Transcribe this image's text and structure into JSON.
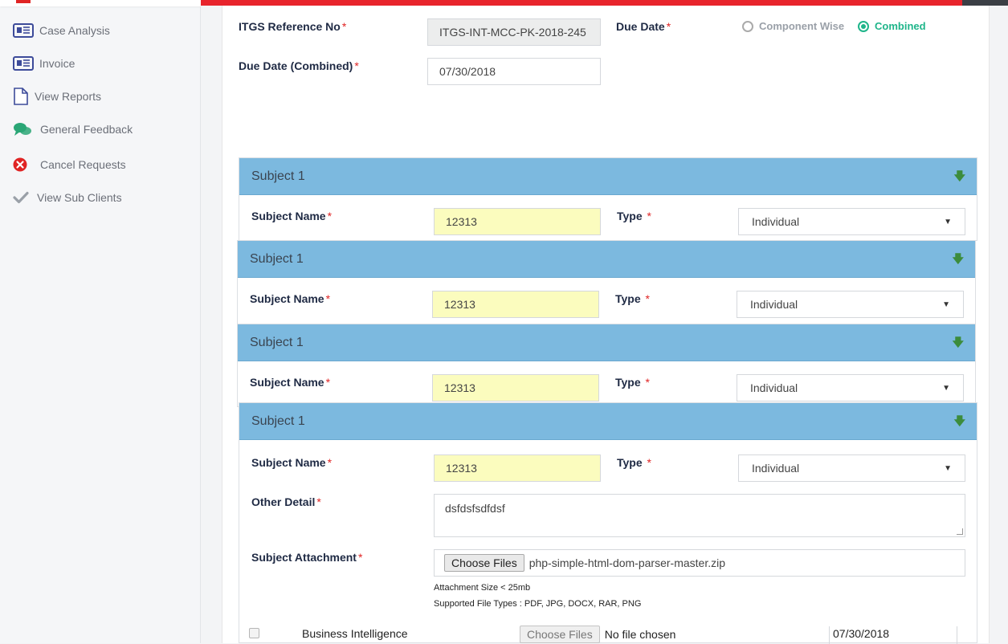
{
  "sidebar": {
    "items": [
      {
        "label": "Case Analysis",
        "icon": "newspaper-icon",
        "color": "#3d4b9a"
      },
      {
        "label": "Invoice",
        "icon": "newspaper-icon",
        "color": "#3d4b9a"
      },
      {
        "label": "View Reports",
        "icon": "document-icon",
        "color": "#3d4b9a"
      },
      {
        "label": "General Feedback",
        "icon": "comments-icon",
        "color": "#2aa676"
      },
      {
        "label": "Cancel Requests",
        "icon": "cancel-circle-icon",
        "color": "#e02424"
      },
      {
        "label": "View Sub Clients",
        "icon": "checkmark-icon",
        "color": "#9aa0a8"
      }
    ]
  },
  "form": {
    "itgs_ref_label": "ITGS Reference No",
    "itgs_ref_value": "ITGS-INT-MCC-PK-2018-245",
    "due_date_label": "Due Date",
    "due_date_options": [
      "Component Wise",
      "Combined"
    ],
    "due_date_selected": "Combined",
    "due_date_combined_label": "Due Date (Combined)",
    "due_date_combined_value": "07/30/2018",
    "required_mark": "*"
  },
  "subjects": [
    {
      "title": "Subject 1",
      "name_label": "Subject Name",
      "name_value": "12313",
      "type_label": "Type",
      "type_value": "Individual"
    },
    {
      "title": "Subject 1",
      "name_label": "Subject Name",
      "name_value": "12313",
      "type_label": "Type",
      "type_value": "Individual"
    },
    {
      "title": "Subject 1",
      "name_label": "Subject Name",
      "name_value": "12313",
      "type_label": "Type",
      "type_value": "Individual"
    },
    {
      "title": "Subject 1",
      "name_label": "Subject Name",
      "name_value": "12313",
      "type_label": "Type",
      "type_value": "Individual"
    }
  ],
  "details": {
    "other_detail_label": "Other Detail",
    "other_detail_value": "dsfdsfsdfdsf",
    "attachment_label": "Subject Attachment",
    "choose_files_label": "Choose Files",
    "attachment_file": "php-simple-html-dom-parser-master.zip",
    "attachment_size_note": "Attachment Size < 25mb",
    "supported_types_note": "Supported File Types : PDF, JPG, DOCX, RAR, PNG"
  },
  "component_row": {
    "name": "Business Intelligence",
    "choose_files_label": "Choose Files",
    "no_file_text": "No file chosen",
    "due_date": "07/30/2018"
  },
  "colors": {
    "top_bar": "#e8242c",
    "panel_header": "#7cb9df",
    "radio_selected": "#1fb58a",
    "input_highlight": "#fbfcbe"
  }
}
